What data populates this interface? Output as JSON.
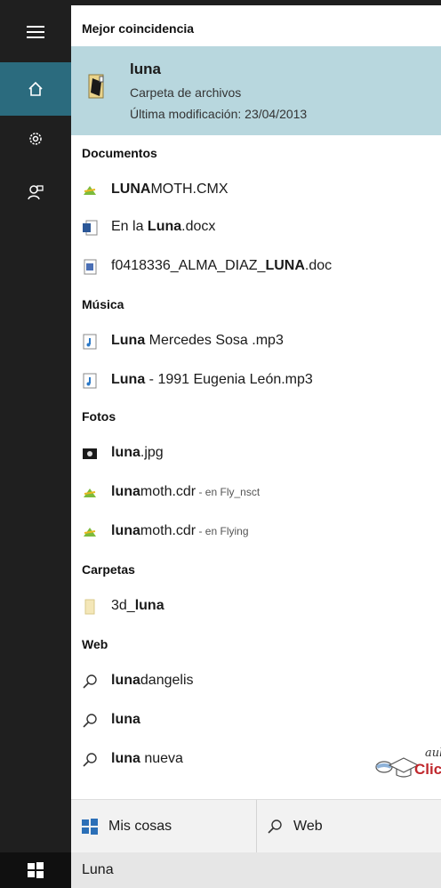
{
  "rail": {
    "items": [
      {
        "name": "hamburger-menu",
        "icon": "menu-icon"
      },
      {
        "name": "home",
        "icon": "home-icon",
        "active": true
      },
      {
        "name": "settings",
        "icon": "gear-icon"
      },
      {
        "name": "feedback",
        "icon": "feedback-icon"
      }
    ]
  },
  "best_match": {
    "header": "Mejor coincidencia",
    "title": "luna",
    "type": "Carpeta de archivos",
    "modified": "Última modificación: 23/04/2013"
  },
  "sections": {
    "documentos": "Documentos",
    "musica": "Música",
    "fotos": "Fotos",
    "carpetas": "Carpetas",
    "web": "Web"
  },
  "documents": [
    {
      "bold": "LUNA",
      "rest": "MOTH.CMX",
      "icon": "coreldraw-icon"
    },
    {
      "pre": "En la ",
      "bold": "Luna",
      "rest": ".docx",
      "icon": "word-doc-icon"
    },
    {
      "pre": "f0418336_ALMA_DIAZ_",
      "bold": "LUNA",
      "rest": ".doc",
      "icon": "word-doc-icon"
    }
  ],
  "music": [
    {
      "bold": "Luna",
      "rest": " Mercedes Sosa .mp3",
      "icon": "audio-file-icon"
    },
    {
      "bold": "Luna",
      "rest": " - 1991 Eugenia León.mp3",
      "icon": "audio-file-icon"
    }
  ],
  "photos": [
    {
      "bold": "luna",
      "rest": ".jpg",
      "icon": "image-file-icon"
    },
    {
      "bold": "luna",
      "rest": "moth.cdr",
      "where": " - en Fly_nsct",
      "icon": "coreldraw-icon"
    },
    {
      "bold": "luna",
      "rest": "moth.cdr",
      "where": " - en Flying",
      "icon": "coreldraw-icon"
    }
  ],
  "folders": [
    {
      "pre": "3d_",
      "bold": "luna",
      "rest": "",
      "icon": "folder-icon"
    }
  ],
  "web": [
    {
      "bold": "luna",
      "rest": "dangelis",
      "icon": "search-icon"
    },
    {
      "bold": "luna",
      "rest": "",
      "icon": "search-icon"
    },
    {
      "bold": "luna",
      "rest": " nueva",
      "icon": "search-icon"
    }
  ],
  "bottom": {
    "my_stuff": "Mis cosas",
    "web": "Web"
  },
  "search": {
    "query": "Luna"
  },
  "watermark": {
    "line1": "aula",
    "line2": "Clic"
  },
  "colors": {
    "rail_bg": "#1f1f1f",
    "active_tab": "#2b6b7e",
    "highlight": "#b8d7de",
    "watermark_red": "#c0282d"
  }
}
